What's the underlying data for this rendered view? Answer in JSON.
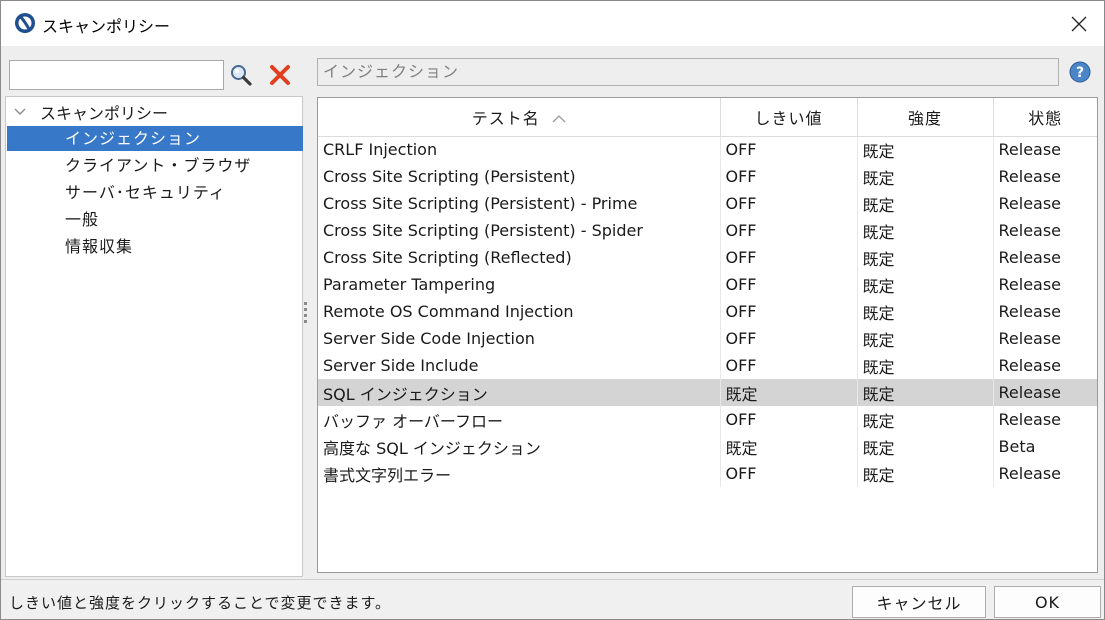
{
  "window": {
    "title": "スキャンポリシー"
  },
  "left": {
    "search_value": "",
    "tree_root": "スキャンポリシー",
    "items": [
      "インジェクション",
      "クライアント・ブラウザ",
      "サーバ･セキュリティ",
      "一般",
      "情報収集"
    ]
  },
  "right": {
    "section_title": "インジェクション",
    "columns": [
      "テスト名",
      "しきい値",
      "強度",
      "状態"
    ],
    "rows": [
      [
        "CRLF Injection",
        "OFF",
        "既定",
        "Release"
      ],
      [
        "Cross Site Scripting (Persistent)",
        "OFF",
        "既定",
        "Release"
      ],
      [
        "Cross Site Scripting (Persistent) - Prime",
        "OFF",
        "既定",
        "Release"
      ],
      [
        "Cross Site Scripting (Persistent) - Spider",
        "OFF",
        "既定",
        "Release"
      ],
      [
        "Cross Site Scripting (Reflected)",
        "OFF",
        "既定",
        "Release"
      ],
      [
        "Parameter Tampering",
        "OFF",
        "既定",
        "Release"
      ],
      [
        "Remote OS Command Injection",
        "OFF",
        "既定",
        "Release"
      ],
      [
        "Server Side Code Injection",
        "OFF",
        "既定",
        "Release"
      ],
      [
        "Server Side Include",
        "OFF",
        "既定",
        "Release"
      ],
      [
        "SQL インジェクション",
        "既定",
        "既定",
        "Release"
      ],
      [
        "バッファ オーバーフロー",
        "OFF",
        "既定",
        "Release"
      ],
      [
        "高度な SQL インジェクション",
        "既定",
        "既定",
        "Beta"
      ],
      [
        "書式文字列エラー",
        "OFF",
        "既定",
        "Release"
      ]
    ],
    "highlighted_row": 9
  },
  "footer": {
    "message": "しきい値と強度をクリックすることで変更できます。",
    "cancel_label": "キャンセル",
    "ok_label": "OK"
  },
  "colors": {
    "selection": "#3878c8",
    "row_highlight": "#d4d4d4",
    "clear_icon": "#e04020",
    "help_icon": "#4a86c8"
  },
  "icons": {
    "search": "magnifier-icon",
    "clear": "red-x-icon",
    "help": "question-icon",
    "sort": "chevron-up-icon",
    "expand": "chevron-down-icon"
  }
}
